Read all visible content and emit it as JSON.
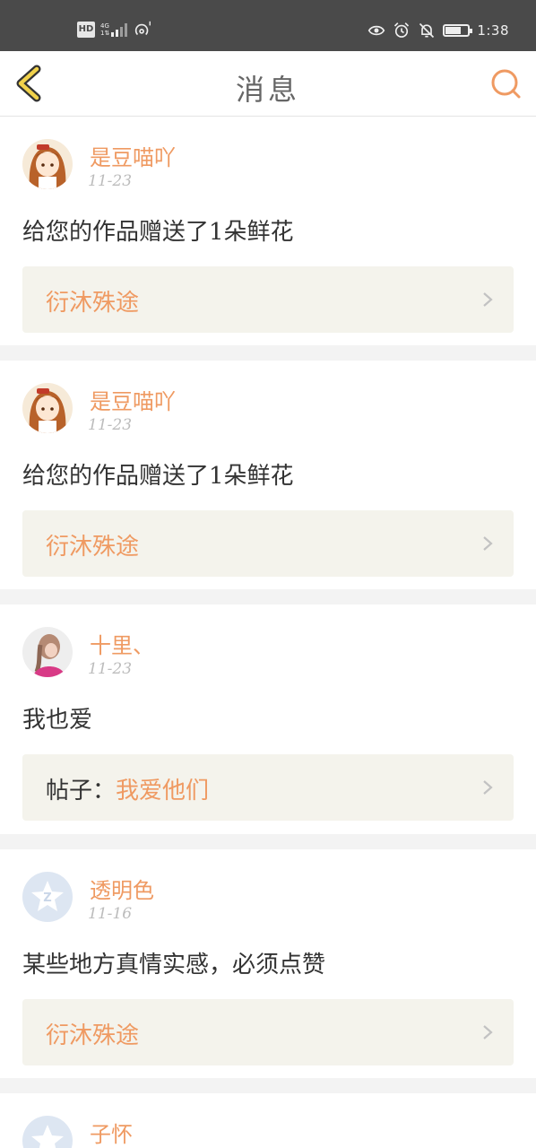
{
  "status_bar": {
    "hd_label": "HD",
    "network_label": "4G",
    "network_sub": "1⇅",
    "time": "1:38",
    "battery_level": 0.7,
    "icons": [
      "hotspot-icon",
      "eye-icon",
      "alarm-icon",
      "bell-off-icon",
      "battery-icon"
    ]
  },
  "header": {
    "title": "消息",
    "back_icon": "chevron-left-icon",
    "search_icon": "search-icon",
    "accent_color": "#ef9a62"
  },
  "messages": [
    {
      "user": "是豆喵吖",
      "date": "11-23",
      "text": "给您的作品赠送了1朵鲜花",
      "ref_prefix": "",
      "ref_title": "衍沐殊途",
      "avatar": "anime-girl-avatar"
    },
    {
      "user": "是豆喵吖",
      "date": "11-23",
      "text": "给您的作品赠送了1朵鲜花",
      "ref_prefix": "",
      "ref_title": "衍沐殊途",
      "avatar": "anime-girl-avatar"
    },
    {
      "user": "十里、",
      "date": "11-23",
      "text": "我也爱",
      "ref_prefix": "帖子：",
      "ref_title": "我爱他们",
      "avatar": "braided-girl-avatar"
    },
    {
      "user": "透明色",
      "date": "11-16",
      "text": "某些地方真情实感，必须点赞",
      "ref_prefix": "",
      "ref_title": "衍沐殊途",
      "avatar": "default-z-avatar"
    },
    {
      "user": "子怀",
      "date": "",
      "text": "",
      "ref_prefix": "",
      "ref_title": "",
      "avatar": "default-z-avatar"
    }
  ]
}
